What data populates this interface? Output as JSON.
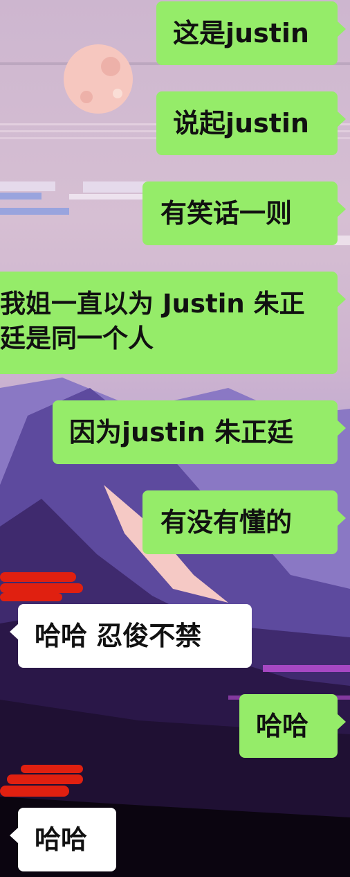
{
  "messages": [
    {
      "side": "sent",
      "text": "这是justin"
    },
    {
      "side": "sent",
      "text": "说起justin"
    },
    {
      "side": "sent",
      "text": "有笑话一则"
    },
    {
      "side": "sent",
      "text": "我姐一直以为 Justin 朱正廷是同一个人"
    },
    {
      "side": "sent",
      "text": "因为justin 朱正廷"
    },
    {
      "side": "sent",
      "text": "有没有懂的"
    },
    {
      "side": "received",
      "text": "哈哈 忍俊不禁"
    },
    {
      "side": "sent",
      "text": "哈哈"
    },
    {
      "side": "received",
      "text": "哈哈"
    }
  ],
  "colors": {
    "sent_bubble": "#95ec69",
    "received_bubble": "#ffffff",
    "redaction_scribble": "#e02010"
  },
  "background": "pixel-art-mountain-moon-wallpaper"
}
